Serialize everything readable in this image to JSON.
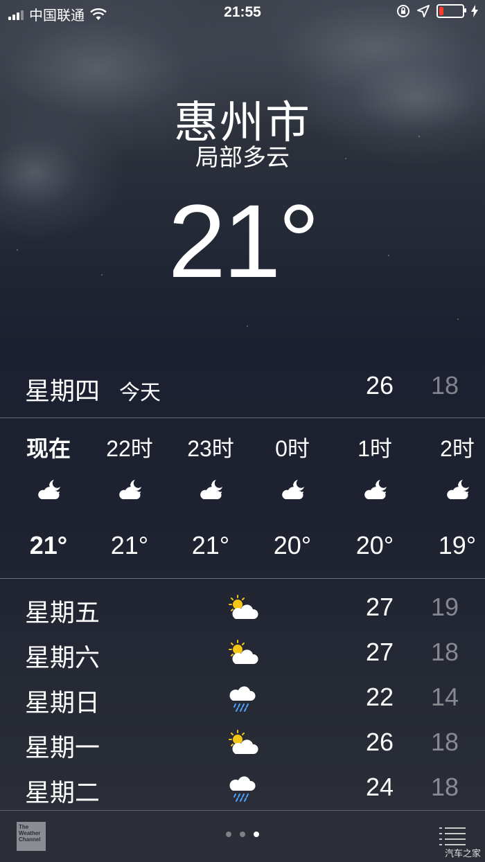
{
  "status_bar": {
    "carrier": "中国联通",
    "time": "21:55",
    "battery_level": 0.2
  },
  "header": {
    "city": "惠州市",
    "condition": "局部多云",
    "temperature": "21°"
  },
  "today": {
    "day": "星期四",
    "label": "今天",
    "high": "26",
    "low": "18"
  },
  "hourly": [
    {
      "time": "现在",
      "icon": "partly-cloudy-night-icon",
      "temp": "21°"
    },
    {
      "time": "22时",
      "icon": "partly-cloudy-night-icon",
      "temp": "21°"
    },
    {
      "time": "23时",
      "icon": "partly-cloudy-night-icon",
      "temp": "21°"
    },
    {
      "time": "0时",
      "icon": "partly-cloudy-night-icon",
      "temp": "20°"
    },
    {
      "time": "1时",
      "icon": "partly-cloudy-night-icon",
      "temp": "20°"
    },
    {
      "time": "2时",
      "icon": "partly-cloudy-night-icon",
      "temp": "19°"
    }
  ],
  "daily": [
    {
      "day": "星期五",
      "icon": "partly-sunny-icon",
      "high": "27",
      "low": "19"
    },
    {
      "day": "星期六",
      "icon": "partly-sunny-icon",
      "high": "27",
      "low": "18"
    },
    {
      "day": "星期日",
      "icon": "rain-icon",
      "high": "22",
      "low": "14"
    },
    {
      "day": "星期一",
      "icon": "partly-sunny-icon",
      "high": "26",
      "low": "18"
    },
    {
      "day": "星期二",
      "icon": "rain-icon",
      "high": "24",
      "low": "18"
    }
  ],
  "bottom_bar": {
    "logo_text": "The Weather Channel",
    "page_count": 3,
    "active_page": 3
  },
  "watermark": "汽车之家",
  "colors": {
    "sun": "#f5c518",
    "rain": "#4aa3ff",
    "battery_low": "#ff3b30"
  }
}
